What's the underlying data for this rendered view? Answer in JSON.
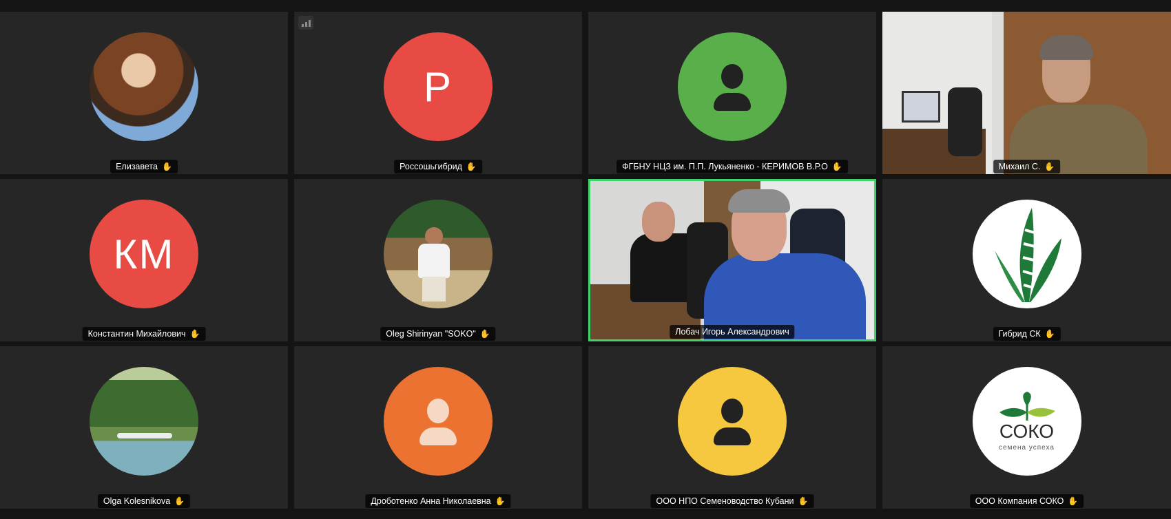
{
  "app": {
    "background": "#141414",
    "tile_background": "#262626",
    "active_speaker_color": "#3fd16a"
  },
  "participants": [
    {
      "name": "Елизавета",
      "avatar": "photo-woman",
      "hand_icon": "raise-hand-icon"
    },
    {
      "name": "Россошьгибрид",
      "initials": "Р",
      "avatar_color": "#e84b43",
      "signal_icon": "signal-bars-icon"
    },
    {
      "name": "ФГБНУ НЦЗ им. П.П. Лукьяненко - КЕРИМОВ В.Р.О",
      "avatar": "person-placeholder-icon",
      "avatar_color": "#59b04a"
    },
    {
      "name": "Михаил С.",
      "avatar": "video-feed"
    },
    {
      "name": "Константин Михайлович",
      "initials": "КМ",
      "avatar_color": "#e84b43"
    },
    {
      "name": "Oleg Shirinyan \"SOKO\"",
      "avatar": "photo-man-outdoors"
    },
    {
      "name": "Лобач Игорь Александрович",
      "avatar": "video-feed",
      "active_speaker": true
    },
    {
      "name": "Гибрид СК",
      "avatar": "logo-gibrid-sk"
    },
    {
      "name": "Olga Kolesnikova",
      "avatar": "photo-lake"
    },
    {
      "name": "Дроботенко Анна Николаевна",
      "avatar": "person-placeholder-icon",
      "avatar_color": "#ec7232"
    },
    {
      "name": "ООО НПО Семеноводство Кубани",
      "avatar": "person-placeholder-icon",
      "avatar_color": "#f5c83f"
    },
    {
      "name": "ООО Компания СОКО",
      "avatar": "logo-soko",
      "logo_text": "СОКО",
      "logo_tagline": "семена успеха"
    }
  ]
}
